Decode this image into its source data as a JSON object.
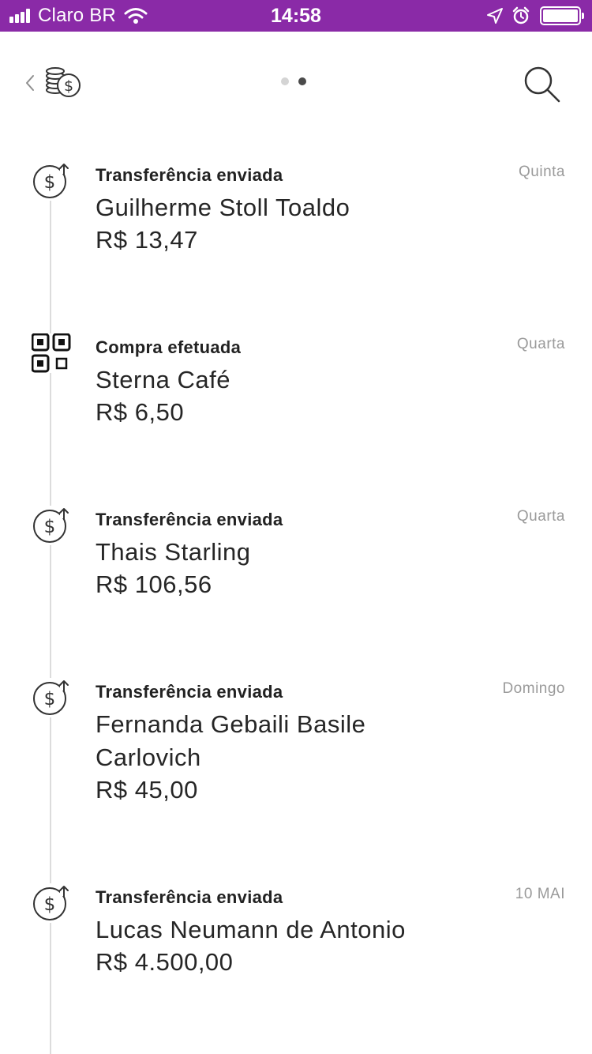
{
  "status_bar": {
    "carrier": "Claro BR",
    "time": "14:58"
  },
  "header": {
    "back_icon": "chevron-left-icon",
    "coins_icon": "coins-dollar-icon",
    "search_icon": "search-icon",
    "page_indicator": {
      "count": 2,
      "active_index": 1
    }
  },
  "feed": [
    {
      "icon": "transfer-dollar-icon",
      "type": "Transferência enviada",
      "name": "Guilherme Stoll Toaldo",
      "amount": "R$ 13,47",
      "date": "Quinta"
    },
    {
      "icon": "qr-code-icon",
      "type": "Compra efetuada",
      "name": "Sterna Café",
      "amount": "R$ 6,50",
      "date": "Quarta"
    },
    {
      "icon": "transfer-dollar-icon",
      "type": "Transferência enviada",
      "name": "Thais Starling",
      "amount": "R$ 106,56",
      "date": "Quarta"
    },
    {
      "icon": "transfer-dollar-icon",
      "type": "Transferência enviada",
      "name": "Fernanda Gebaili Basile Carlovich",
      "amount": "R$ 45,00",
      "date": "Domingo"
    },
    {
      "icon": "transfer-dollar-icon",
      "type": "Transferência enviada",
      "name": "Lucas Neumann de Antonio",
      "amount": "R$ 4.500,00",
      "date": "10 MAI"
    }
  ],
  "colors": {
    "status_bar_bg": "#8a2aa7",
    "text_primary": "#262626",
    "text_secondary": "#9a9a9a",
    "timeline": "#dcdcdc"
  }
}
